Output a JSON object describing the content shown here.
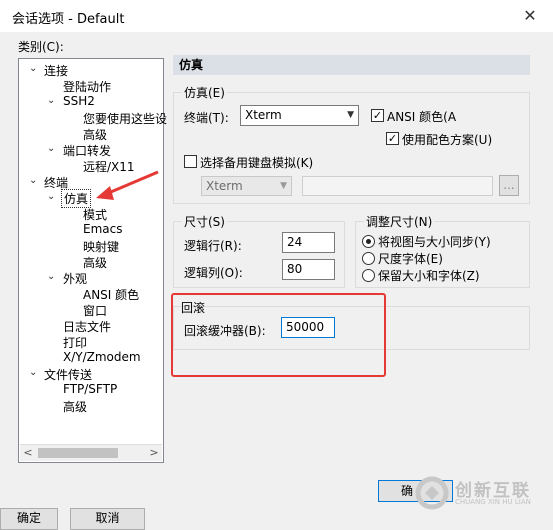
{
  "window": {
    "title": "会话选项 - Default",
    "close_glyph": "✕"
  },
  "category_label": "类别(C):",
  "tree": [
    {
      "label": "连接",
      "twisty": "⌄"
    },
    {
      "label": "登陆动作"
    },
    {
      "label": "SSH2",
      "twisty": "⌄"
    },
    {
      "label": "您要使用这些设"
    },
    {
      "label": "高级"
    },
    {
      "label": "端口转发",
      "twisty": "⌄"
    },
    {
      "label": "远程/X11"
    },
    {
      "label": "终端",
      "twisty": "⌄"
    },
    {
      "label": "仿真",
      "twisty": "⌄"
    },
    {
      "label": "模式"
    },
    {
      "label": "Emacs"
    },
    {
      "label": "映射键"
    },
    {
      "label": "高级"
    },
    {
      "label": "外观",
      "twisty": "⌄"
    },
    {
      "label": "ANSI 颜色"
    },
    {
      "label": "窗口"
    },
    {
      "label": "日志文件"
    },
    {
      "label": "打印"
    },
    {
      "label": "X/Y/Zmodem"
    },
    {
      "label": "文件传送",
      "twisty": "⌄"
    },
    {
      "label": "FTP/SFTP"
    },
    {
      "label": "高级"
    }
  ],
  "scroll": {
    "left": "<",
    "right": ">"
  },
  "panel": {
    "title": "仿真",
    "emulation": {
      "group": "仿真(E)",
      "terminal_label": "终端(T):",
      "terminal_value": "Xterm",
      "ansi_color": "ANSI 颜色(A",
      "ansi_checked": "✓",
      "use_color_scheme": "使用配色方案(U)",
      "scheme_checked": "✓",
      "alt_keyboard": "选择备用键盘模拟(K)",
      "alt_keyboard_value": "Xterm",
      "browse": "..."
    },
    "size": {
      "group": "尺寸(S)",
      "rows_label": "逻辑行(R):",
      "rows_value": "24",
      "cols_label": "逻辑列(O):",
      "cols_value": "80"
    },
    "resize": {
      "group": "调整尺寸(N)",
      "opt1": "将视图与大小同步(Y)",
      "opt2": "尺度字体(E)",
      "opt3": "保留大小和字体(Z)"
    },
    "scrollback": {
      "group": "回滚",
      "buffer_label": "回滚缓冲器(B):",
      "buffer_value": "50000"
    }
  },
  "buttons": {
    "ok": "确定",
    "cancel": "取消",
    "ok_partial": "确"
  },
  "watermark": {
    "cn": "创新互联",
    "en": "CHUANG XIN HU LIAN"
  },
  "colors": {
    "highlight_red": "#e53935",
    "section_header": "#dbdfe6"
  }
}
